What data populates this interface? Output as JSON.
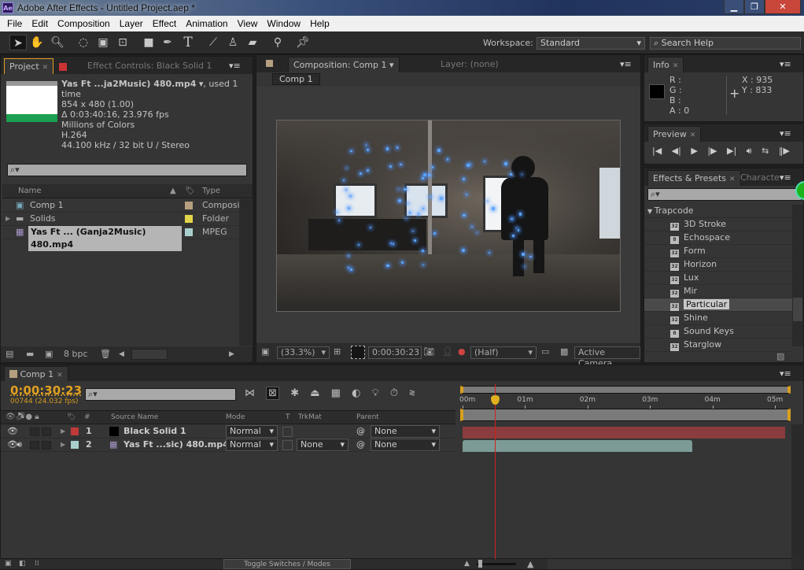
{
  "window": {
    "title": "Adobe After Effects - Untitled Project.aep *",
    "logo": "Ae",
    "controls": [
      "minimize-icon",
      "maximize-icon",
      "close-icon"
    ]
  },
  "menu": [
    "File",
    "Edit",
    "Composition",
    "Layer",
    "Effect",
    "Animation",
    "View",
    "Window",
    "Help"
  ],
  "toolbar": {
    "tools": [
      "selection-tool-icon",
      "hand-tool-icon",
      "zoom-tool-icon",
      "rotation-tool-icon",
      "camera-tool-icon",
      "pan-behind-tool-icon",
      "rectangle-tool-icon",
      "pen-tool-icon",
      "type-tool-icon",
      "brush-tool-icon",
      "clone-stamp-tool-icon",
      "eraser-tool-icon",
      "roto-brush-tool-icon",
      "puppet-pin-tool-icon"
    ],
    "workspace_label": "Workspace:",
    "workspace_value": "Standard",
    "search_placeholder": "Search Help"
  },
  "project": {
    "tab": "Project",
    "tab2": "Effect Controls: Black Solid 1",
    "footage": {
      "name": "Yas Ft ...ja2Music) 480.mp4",
      "used": ", used 1 time",
      "dims": "854 x 480 (1.00)",
      "duration": "Δ 0:03:40:16, 23.976 fps",
      "colors": "Millions of Colors",
      "codec": "H.264",
      "audio": "44.100 kHz / 32 bit U / Stereo"
    },
    "columns": {
      "name": "Name",
      "type": "Type"
    },
    "items": [
      {
        "name": "Comp 1",
        "type": "Composi",
        "label_color": "#b59f7f",
        "icon": "composition-icon"
      },
      {
        "name": "Solids",
        "type": "Folder",
        "label_color": "#e3d64a",
        "icon": "folder-icon"
      },
      {
        "name": "Yas Ft ... (Ganja2Music) 480.mp4",
        "type": "MPEG",
        "label_color": "#a7d0cc",
        "icon": "footage-icon"
      }
    ],
    "bpc": "8 bpc"
  },
  "composition": {
    "tab": "Composition: Comp 1",
    "layer_tab": "Layer: (none)",
    "sub_tab": "Comp 1",
    "zoom": "(33.3%)",
    "timecode": "0:00:30:23",
    "resolution": "(Half)",
    "view": "Active Camera"
  },
  "info": {
    "tab": "Info",
    "r": "R :",
    "g": "G :",
    "b": "B :",
    "a": "A : 0",
    "x": "X : 935",
    "y": "Y : 833"
  },
  "preview": {
    "tab": "Preview",
    "controls": [
      "first-frame-icon",
      "previous-frame-icon",
      "play-icon",
      "next-frame-icon",
      "last-frame-icon",
      "audio-icon",
      "loop-icon",
      "ram-preview-icon"
    ]
  },
  "effects": {
    "tab": "Effects & Presets",
    "tab2": "Characte",
    "category": "Trapcode",
    "items": [
      {
        "name": "3D Stroke",
        "bits": "32"
      },
      {
        "name": "Echospace",
        "bits": "8"
      },
      {
        "name": "Form",
        "bits": "32"
      },
      {
        "name": "Horizon",
        "bits": "32"
      },
      {
        "name": "Lux",
        "bits": "32"
      },
      {
        "name": "Mir",
        "bits": "32"
      },
      {
        "name": "Particular",
        "bits": "32",
        "selected": true
      },
      {
        "name": "Shine",
        "bits": "32"
      },
      {
        "name": "Sound Keys",
        "bits": "8"
      },
      {
        "name": "Starglow",
        "bits": "32"
      }
    ]
  },
  "timeline": {
    "tab": "Comp 1",
    "timecode": "0:00:30:23",
    "frames": "00744 (24.032 fps)",
    "columns": {
      "num": "#",
      "source": "Source Name",
      "mode": "Mode",
      "t": "T",
      "trkmat": "TrkMat",
      "parent": "Parent"
    },
    "layers": [
      {
        "num": "1",
        "name": "Black Solid 1",
        "mode": "Normal",
        "trkmat": "",
        "parent": "None",
        "label_color": "#c03a3a",
        "bar_color": "#8a3c3e",
        "end_min": 5.2
      },
      {
        "num": "2",
        "name": "Yas Ft ...sic) 480.mp4",
        "mode": "Normal",
        "trkmat": "None",
        "parent": "None",
        "label_color": "#a7d0cc",
        "bar_color": "#7c9a96",
        "end_min": 3.68
      }
    ],
    "ruler": [
      "00m",
      "01m",
      "02m",
      "03m",
      "04m",
      "05m"
    ],
    "current_time_min": 0.515,
    "toggle": "Toggle Switches / Modes"
  }
}
